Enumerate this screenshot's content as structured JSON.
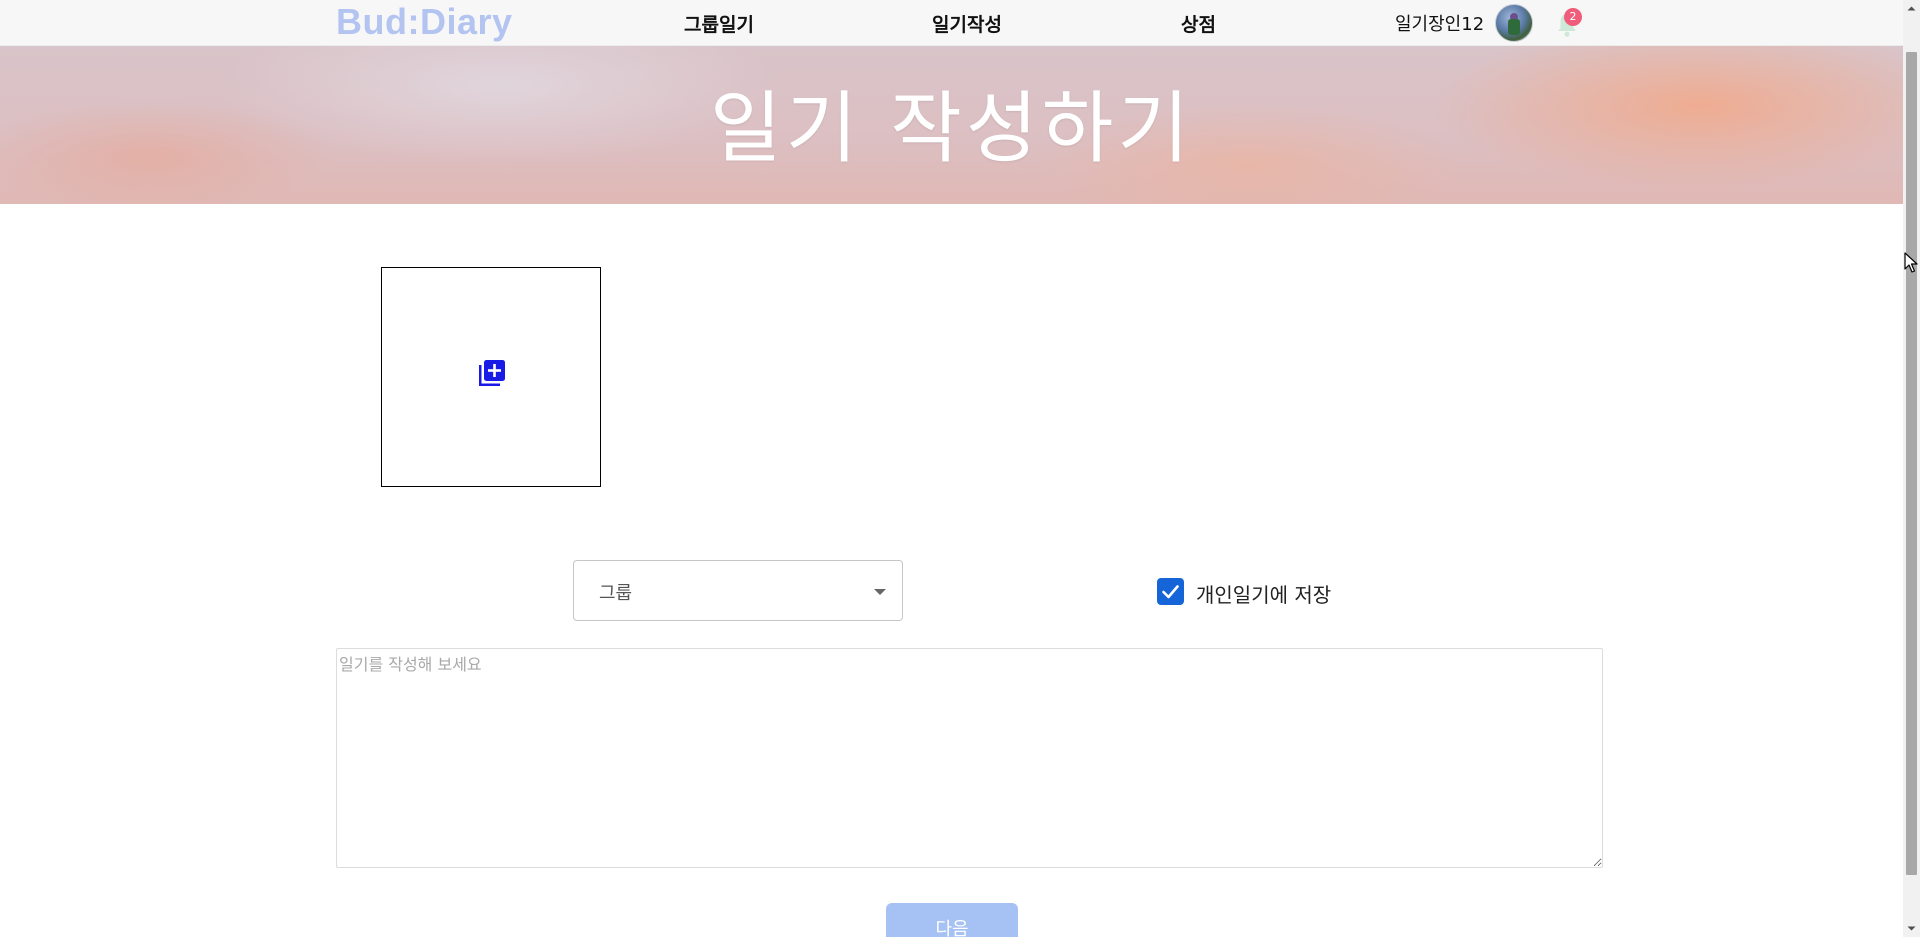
{
  "navbar": {
    "logo": "Bud:Diary",
    "items": [
      {
        "label": "그룹일기"
      },
      {
        "label": "일기작성"
      },
      {
        "label": "상점"
      }
    ],
    "username": "일기장인12",
    "notification_count": "2",
    "logo_color": "#b3c4f1"
  },
  "hero": {
    "title": "일기 작성하기"
  },
  "upload": {
    "icon": "add-photo-icon",
    "icon_color": "#1a1ae6"
  },
  "form": {
    "group_select_label": "그룹",
    "save_personal_label": "개인일기에 저장",
    "save_personal_checked": true,
    "diary_placeholder": "일기를 작성해 보세요",
    "diary_value": "",
    "next_button": "다음",
    "accent_color": "#1565d8",
    "button_color": "#a6c1f3"
  }
}
